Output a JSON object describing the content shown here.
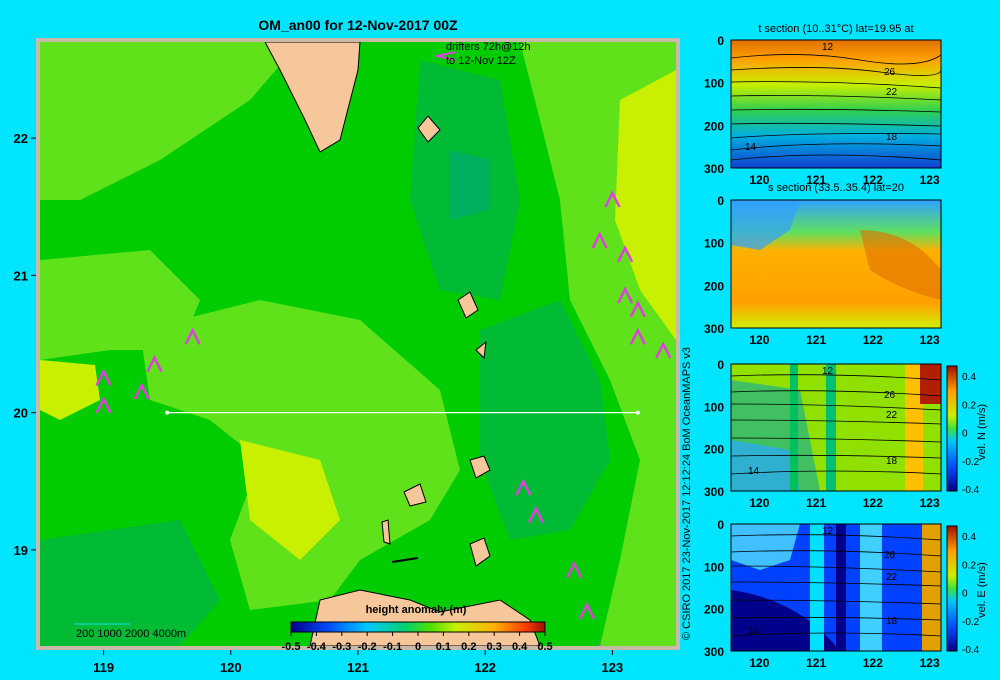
{
  "header": {
    "title": "OM_an00 for 12-Nov-2017 00Z"
  },
  "drifters": {
    "line1": "drifters 72h@12h",
    "line2": "to 12-Nov 12Z"
  },
  "side_credit": "© CSIRO 2017   23-Nov-2017 12:12:24 BoM OceanMAPS v3",
  "colorbar": {
    "label": "height anomaly (m)",
    "ticks": [
      "-0.5",
      "-0.4",
      "-0.3",
      "-0.2",
      "-0.1",
      "0",
      "0.1",
      "0.2",
      "0.3",
      "0.4",
      "0.5"
    ]
  },
  "depth_legend": {
    "label": "200  1000  2000  4000m"
  },
  "colors": {
    "background": "#00e5ff",
    "land": "#f5c79a",
    "sea_mid": "#00cc00",
    "sea_light": "#5fe21a",
    "arrow": "#e040e0",
    "section_line": "#ffffff"
  },
  "chart_data": [
    {
      "type": "heatmap",
      "title": "OM_an00 for 12-Nov-2017 00Z",
      "xlabel": "",
      "ylabel": "",
      "xlim": [
        118.5,
        123.5
      ],
      "ylim": [
        18.3,
        22.7
      ],
      "x_ticks": [
        "119",
        "120",
        "121",
        "122",
        "123"
      ],
      "y_ticks": [
        "19",
        "20",
        "21",
        "22"
      ],
      "colorbar": {
        "label": "height anomaly (m)",
        "min": -0.5,
        "max": 0.5
      },
      "section_line": {
        "lat": 20,
        "lon_start": 119.5,
        "lon_end": 123.2
      },
      "drifter_arrows": [
        {
          "lon": 123.0,
          "lat": 21.6
        },
        {
          "lon": 122.9,
          "lat": 21.3
        },
        {
          "lon": 123.1,
          "lat": 21.2
        },
        {
          "lon": 123.1,
          "lat": 20.9
        },
        {
          "lon": 123.2,
          "lat": 20.8
        },
        {
          "lon": 123.2,
          "lat": 20.6
        },
        {
          "lon": 123.4,
          "lat": 20.5
        },
        {
          "lon": 119.7,
          "lat": 20.6
        },
        {
          "lon": 119.4,
          "lat": 20.4
        },
        {
          "lon": 119.3,
          "lat": 20.2
        },
        {
          "lon": 119.0,
          "lat": 20.3
        },
        {
          "lon": 119.0,
          "lat": 20.1
        },
        {
          "lon": 122.3,
          "lat": 19.5
        },
        {
          "lon": 122.4,
          "lat": 19.3
        },
        {
          "lon": 122.7,
          "lat": 18.9
        },
        {
          "lon": 122.8,
          "lat": 18.6
        },
        {
          "lon": 122.9,
          "lat": 18.3
        }
      ]
    },
    {
      "type": "heatmap",
      "title": "t section (10..31°C) lat=19.95 at",
      "xlim": [
        119.5,
        123.2
      ],
      "ylim": [
        300,
        0
      ],
      "x_ticks": [
        "120",
        "121",
        "122",
        "123"
      ],
      "y_ticks": [
        "0",
        "100",
        "200",
        "300"
      ],
      "contour_labels": [
        "12",
        "26",
        "22",
        "18",
        "14"
      ]
    },
    {
      "type": "heatmap",
      "title": "s section (33.5..35.4) lat=20",
      "xlim": [
        119.5,
        123.2
      ],
      "ylim": [
        300,
        0
      ],
      "x_ticks": [
        "120",
        "121",
        "122",
        "123"
      ],
      "y_ticks": [
        "0",
        "100",
        "200",
        "300"
      ]
    },
    {
      "type": "heatmap",
      "title": "",
      "xlim": [
        119.5,
        123.2
      ],
      "ylim": [
        300,
        0
      ],
      "x_ticks": [
        "120",
        "121",
        "122",
        "123"
      ],
      "y_ticks": [
        "0",
        "100",
        "200",
        "300"
      ],
      "contour_labels": [
        "12",
        "26",
        "22",
        "18",
        "14"
      ],
      "colorbar": {
        "label": "vel. N  (m/s)",
        "ticks": [
          "0.4",
          "0.2",
          "0",
          "-0.2",
          "-0.4"
        ]
      }
    },
    {
      "type": "heatmap",
      "title": "",
      "xlim": [
        119.5,
        123.2
      ],
      "ylim": [
        300,
        0
      ],
      "x_ticks": [
        "120",
        "121",
        "122",
        "123"
      ],
      "y_ticks": [
        "0",
        "100",
        "200",
        "300"
      ],
      "contour_labels": [
        "12",
        "26",
        "22",
        "18",
        "14"
      ],
      "colorbar": {
        "label": "vel. E  (m/s)",
        "ticks": [
          "0.4",
          "0.2",
          "0",
          "-0.2",
          "-0.4"
        ]
      }
    }
  ]
}
